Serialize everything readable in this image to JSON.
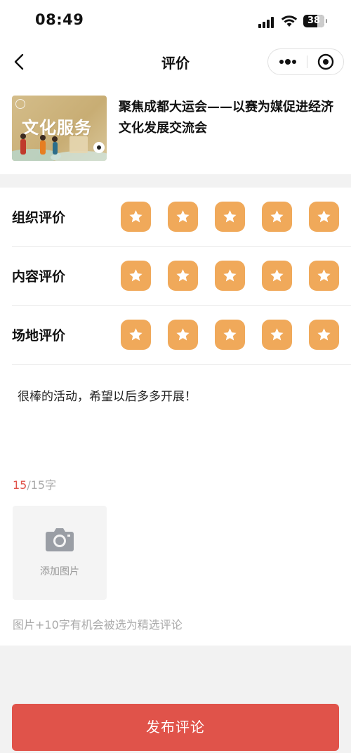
{
  "status_bar": {
    "time": "08:49",
    "battery": "38"
  },
  "nav": {
    "title": "评价"
  },
  "event": {
    "thumbnail_text": "文化服务",
    "title": "聚焦成都大运会——以赛为媒促进经济文化发展交流会"
  },
  "ratings": [
    {
      "label": "组织评价",
      "stars": 5,
      "max": 5
    },
    {
      "label": "内容评价",
      "stars": 5,
      "max": 5
    },
    {
      "label": "场地评价",
      "stars": 5,
      "max": 5
    }
  ],
  "comment": {
    "text": "很棒的活动，希望以后多多开展！",
    "count": "15",
    "limit": "/15字"
  },
  "photo": {
    "add_label": "添加图片"
  },
  "hint": "图片+10字有机会被选为精选评论",
  "publish_button": "发布评论",
  "colors": {
    "star": "#f0a95a",
    "accent": "#e0534a"
  },
  "icons": [
    "back-icon",
    "more-icon",
    "close-target-icon",
    "star-icon",
    "camera-icon"
  ]
}
